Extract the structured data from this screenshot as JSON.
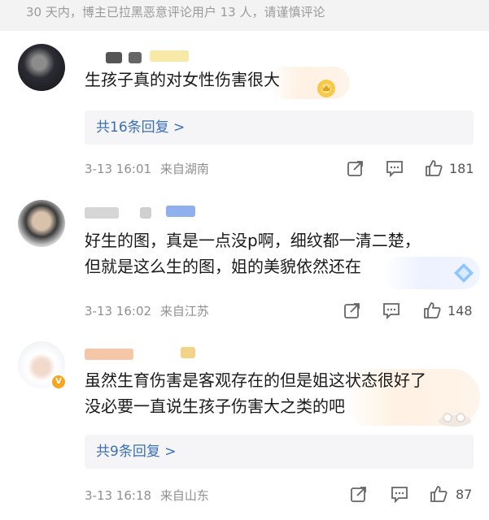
{
  "notice": "30 天内，博主已拉黑恶意评论用户 13 人，请谨慎评论",
  "comments": [
    {
      "content_lines": [
        "生孩子真的对女性伤害很大"
      ],
      "reply_label": "共16条回复 >",
      "time": "3-13 16:01",
      "location": "来自湖南",
      "likes": "181"
    },
    {
      "content_lines": [
        "好生的图，真是一点没p啊，细纹都一清二楚，",
        "但就是这么生的图，姐的美貌依然还在"
      ],
      "time": "3-13 16:02",
      "location": "来自江苏",
      "likes": "148"
    },
    {
      "content_lines": [
        "虽然生育伤害是客观存在的但是姐这状态很好了",
        "没必要一直说生孩子伤害大之类的吧"
      ],
      "reply_label": "共9条回复 >",
      "time": "3-13 16:18",
      "location": "来自山东",
      "likes": "87"
    }
  ],
  "icons": [
    "share-icon",
    "comment-icon",
    "like-icon"
  ],
  "colors": {
    "link": "#3a6fb5",
    "meta": "#8f8f8f",
    "reply_bg": "#f5f5f7"
  }
}
